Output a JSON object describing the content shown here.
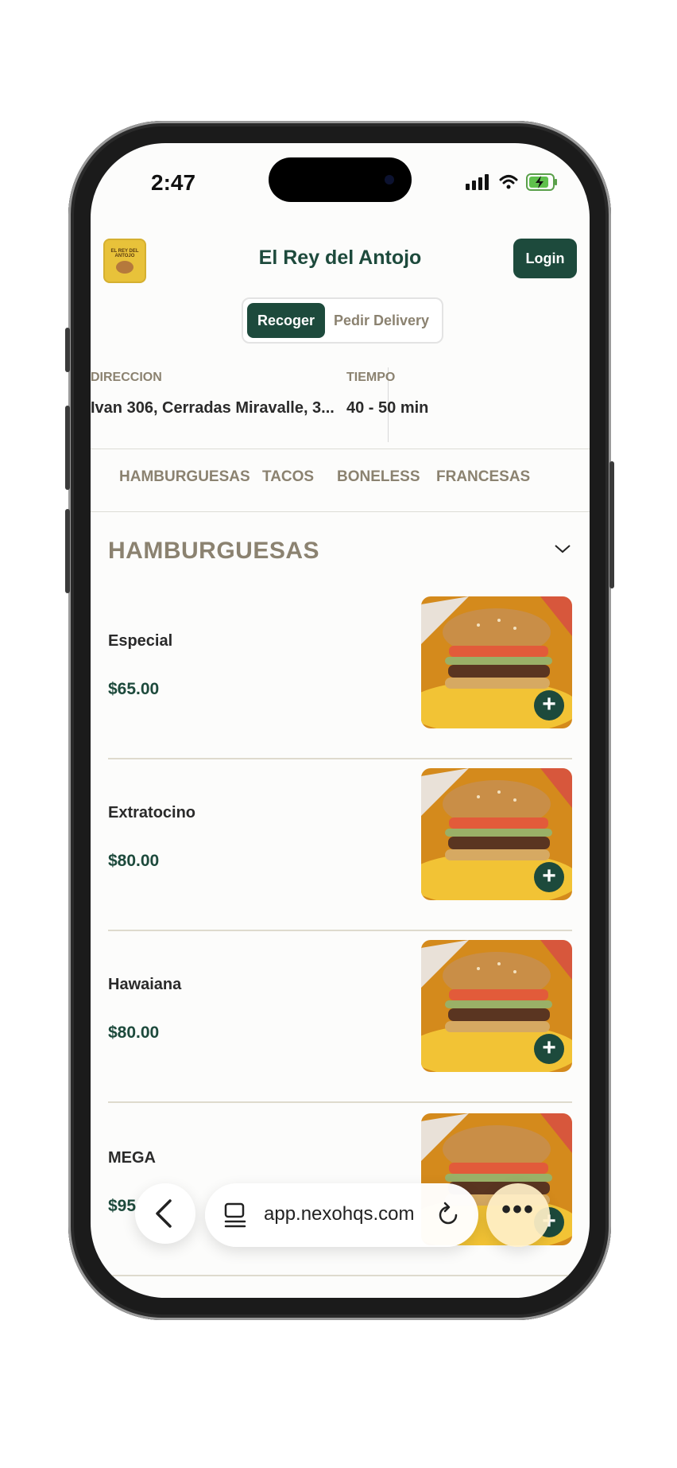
{
  "status_bar": {
    "time": "2:47"
  },
  "header": {
    "title": "El Rey del Antojo",
    "login_label": "Login",
    "logo_text": "EL REY DEL ANTOJO"
  },
  "mode_toggle": {
    "options": [
      "Recoger",
      "Pedir Delivery"
    ],
    "selected": "Recoger"
  },
  "info": {
    "address_label": "DIRECCION",
    "address_value": "Ivan 306, Cerradas Miravalle, 3...",
    "time_label": "TIEMPO",
    "time_value": "40 - 50 min"
  },
  "category_tabs": [
    "HAMBURGUESAS",
    "TACOS",
    "BONELESS",
    "FRANCESAS"
  ],
  "section": {
    "title": "HAMBURGUESAS"
  },
  "items": [
    {
      "name": "Especial",
      "price": "$65.00"
    },
    {
      "name": "Extratocino",
      "price": "$80.00"
    },
    {
      "name": "Hawaiana",
      "price": "$80.00"
    },
    {
      "name": "MEGA",
      "price": "$95"
    }
  ],
  "browser": {
    "url": "app.nexohqs.com"
  },
  "colors": {
    "brand_green": "#1d4a3c",
    "muted_label": "#8b8270"
  }
}
